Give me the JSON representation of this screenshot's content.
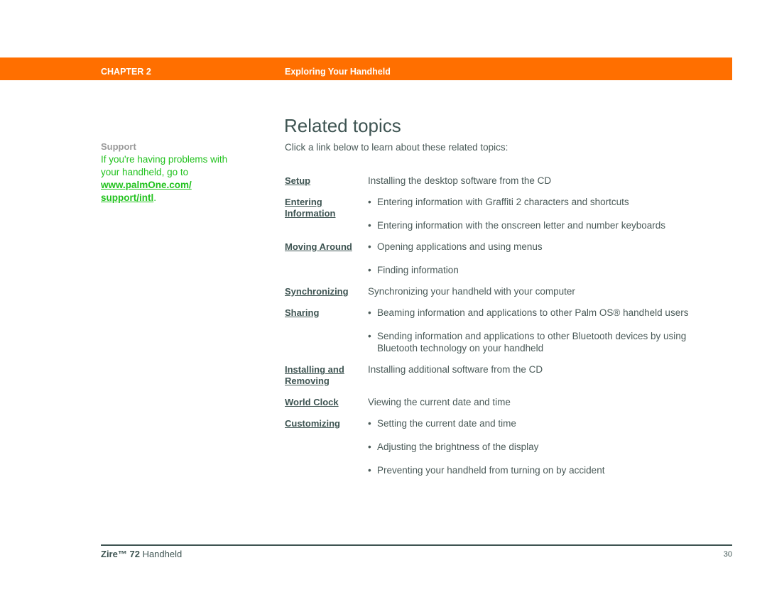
{
  "header": {
    "chapter": "CHAPTER 2",
    "title": "Exploring Your Handheld",
    "bar_color": "#ff6f00"
  },
  "sidebar": {
    "title": "Support",
    "text": "If you're having problems with your handheld, go to ",
    "link": "www.palmOne.com/ support/intl",
    "suffix": ".",
    "accent_color": "#22c21e"
  },
  "main": {
    "title": "Related topics",
    "intro": "Click a link below to learn about these related topics:",
    "topics": [
      {
        "link": "Setup",
        "items": [
          "Installing the desktop software from the CD"
        ],
        "bulleted": false
      },
      {
        "link": "Entering Information",
        "items": [
          "Entering information with Graffiti 2 characters and shortcuts",
          "Entering information with the onscreen letter and number keyboards"
        ],
        "bulleted": true
      },
      {
        "link": "Moving Around",
        "items": [
          "Opening applications and using menus",
          "Finding information"
        ],
        "bulleted": true
      },
      {
        "link": "Synchronizing",
        "items": [
          "Synchronizing your handheld with your computer"
        ],
        "bulleted": false
      },
      {
        "link": "Sharing",
        "items": [
          "Beaming information and applications to other Palm OS® handheld users",
          "Sending information and applications to other Bluetooth devices by using Bluetooth technology on your handheld"
        ],
        "bulleted": true
      },
      {
        "link": "Installing and Removing",
        "items": [
          "Installing additional software from the CD"
        ],
        "bulleted": false
      },
      {
        "link": "World Clock",
        "items": [
          "Viewing the current date and time"
        ],
        "bulleted": false
      },
      {
        "link": "Customizing",
        "items": [
          "Setting the current date and time",
          "Adjusting the brightness of the display",
          "Preventing your handheld from turning on by accident"
        ],
        "bulleted": true
      }
    ]
  },
  "footer": {
    "product_name": "Zire™",
    "product_model": "72",
    "product_suffix": "Handheld",
    "page_number": "30"
  }
}
